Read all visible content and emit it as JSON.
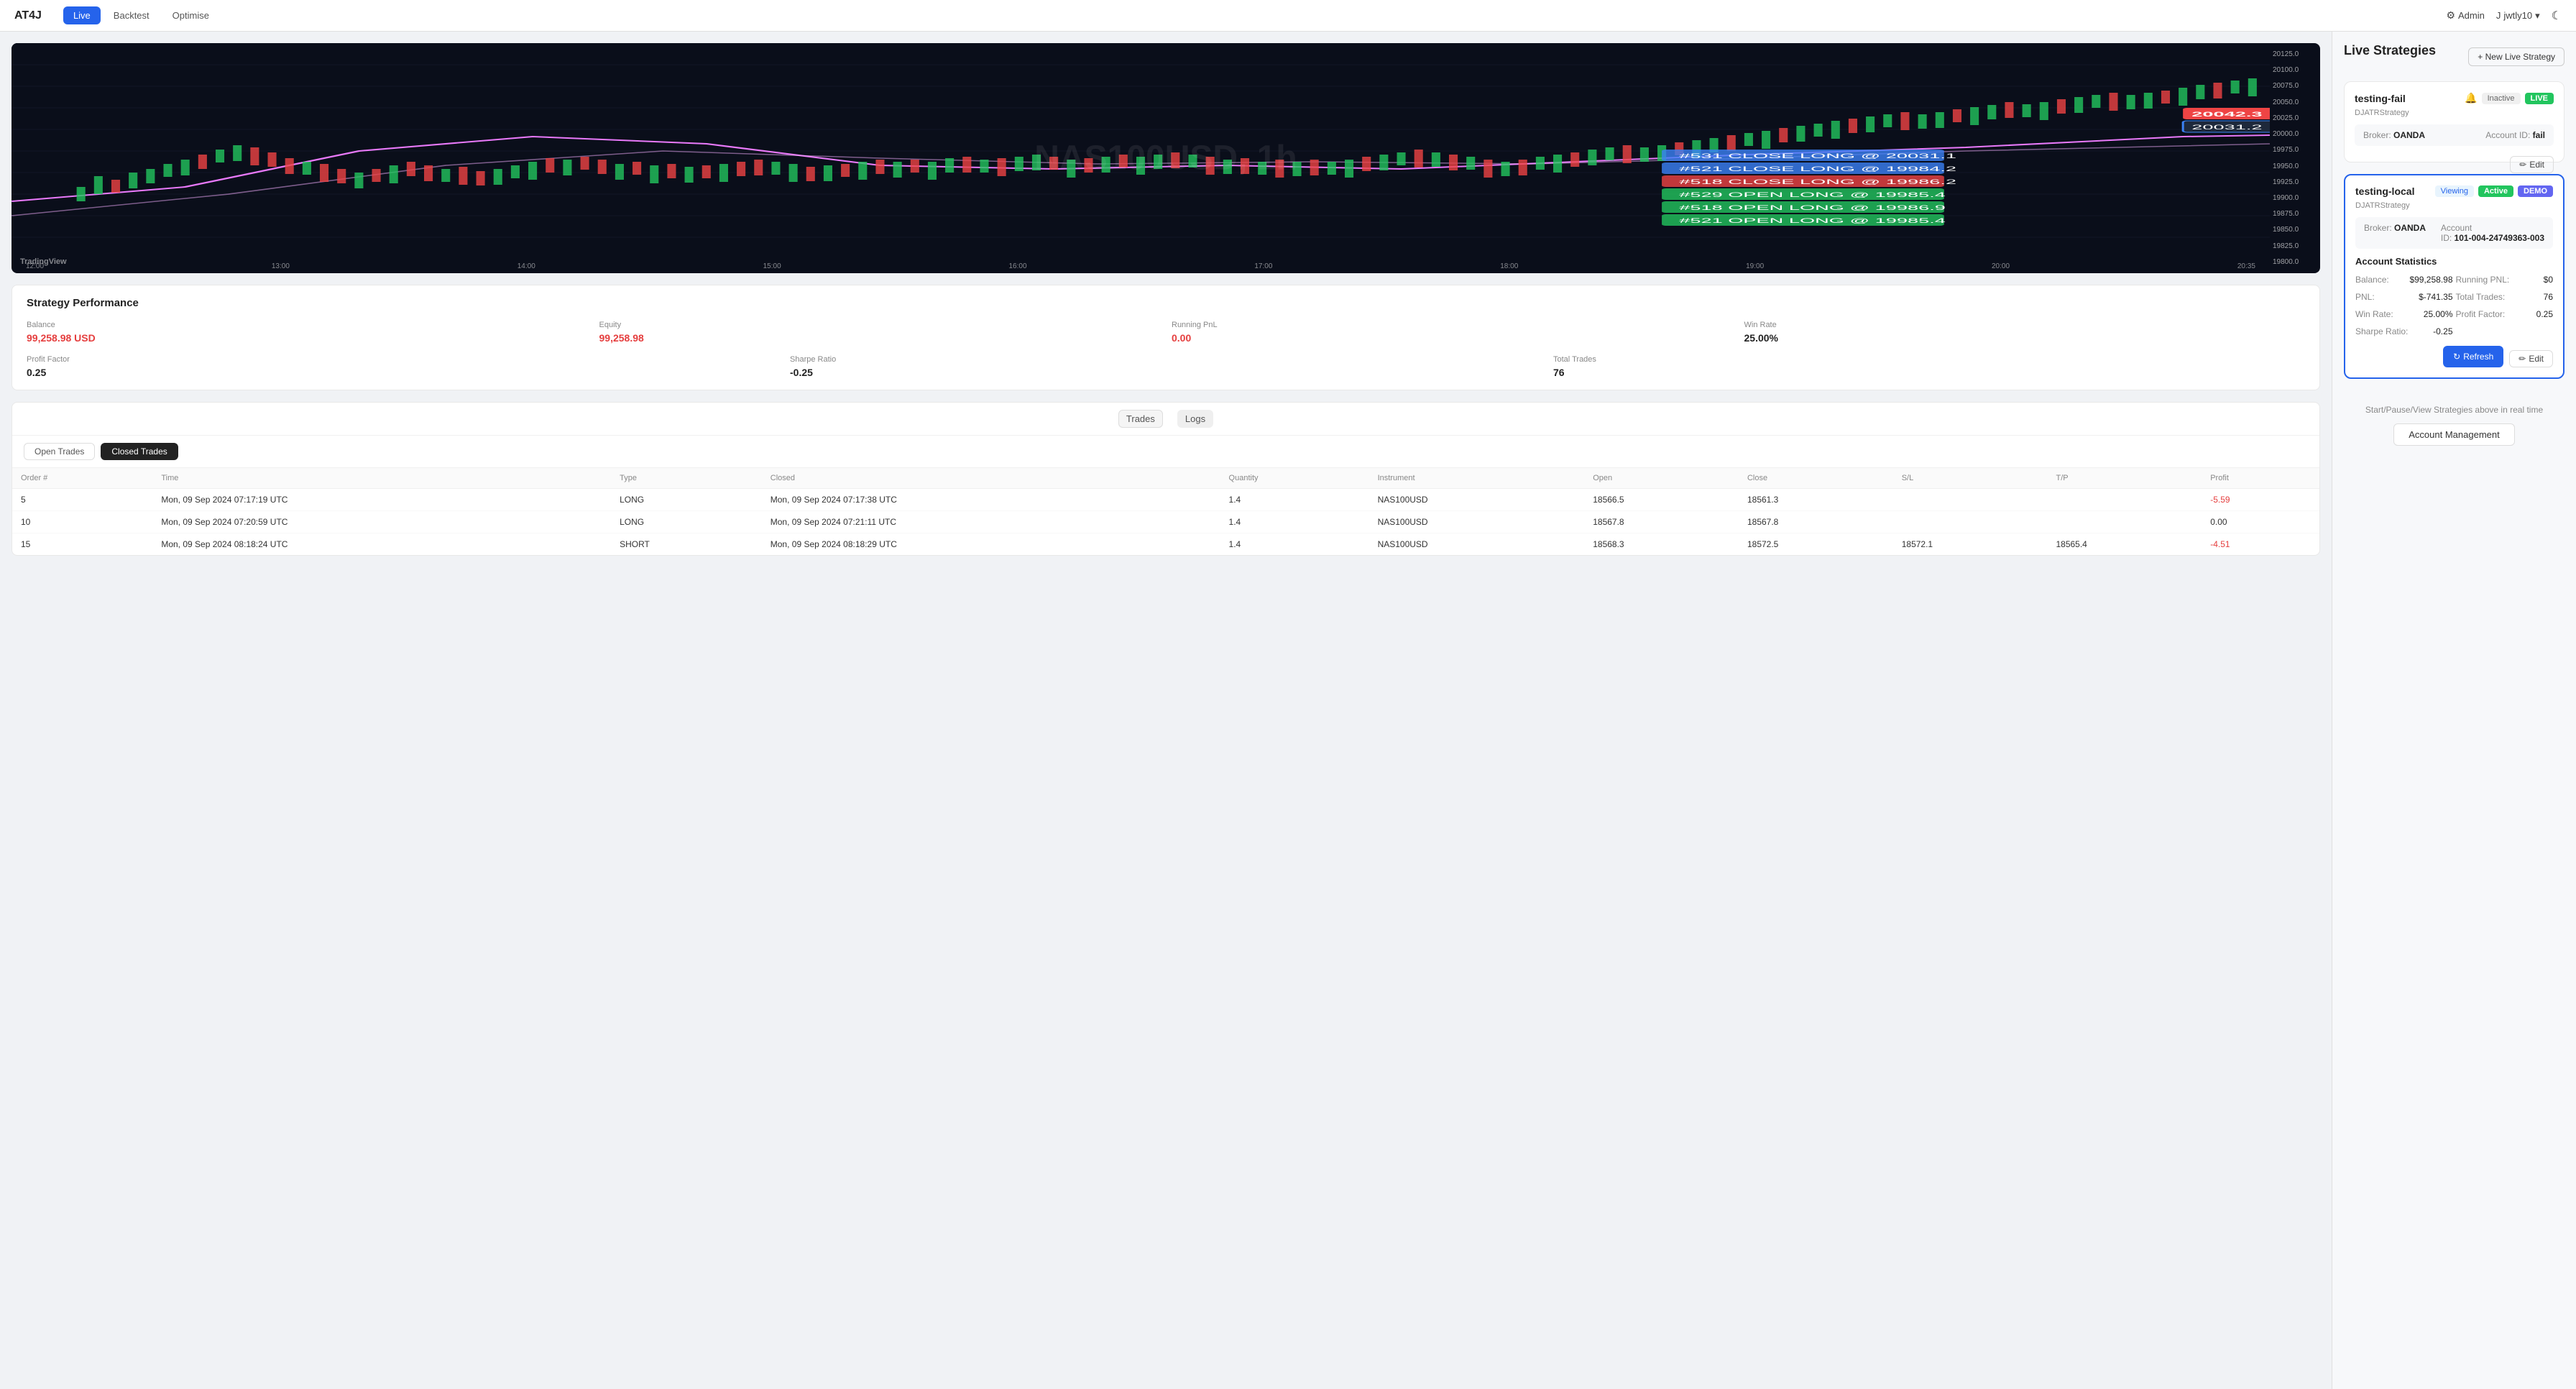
{
  "app": {
    "logo": "AT4J",
    "nav_tabs": [
      {
        "label": "Live",
        "active": true
      },
      {
        "label": "Backtest",
        "active": false
      },
      {
        "label": "Optimise",
        "active": false
      }
    ],
    "admin_label": "Admin",
    "user_label": "jwtly10",
    "theme_icon": "☾"
  },
  "chart": {
    "watermark": "NAS100USD, 1h",
    "tv_logo": "TradingView",
    "prices": [
      "20125.0",
      "20100.0",
      "20075.0",
      "20050.0",
      "20025.0",
      "20000.0",
      "19975.0",
      "19950.0",
      "19925.0",
      "19900.0",
      "19875.0",
      "19850.0",
      "19825.0",
      "19800.0"
    ],
    "times": [
      "12:00",
      "13:00",
      "14:00",
      "15:00",
      "16:00",
      "17:00",
      "18:00",
      "19:00",
      "20:00",
      "20:35"
    ],
    "price_highlight_1": "20042.3",
    "price_highlight_2": "20031.2"
  },
  "performance": {
    "title": "Strategy Performance",
    "balance_label": "Balance",
    "balance_val": "99,258.98 USD",
    "equity_label": "Equity",
    "equity_val": "99,258.98",
    "running_pnl_label": "Running PnL",
    "running_pnl_val": "0.00",
    "win_rate_label": "Win Rate",
    "win_rate_val": "25.00%",
    "profit_factor_label": "Profit Factor",
    "profit_factor_val": "0.25",
    "sharpe_ratio_label": "Sharpe Ratio",
    "sharpe_ratio_val": "-0.25",
    "total_trades_label": "Total Trades",
    "total_trades_val": "76"
  },
  "trades": {
    "tabs": [
      {
        "label": "Trades",
        "active": true
      },
      {
        "label": "Logs",
        "active": false
      }
    ],
    "subtabs": [
      {
        "label": "Open Trades",
        "active": false
      },
      {
        "label": "Closed Trades",
        "active": true
      }
    ],
    "columns": [
      "Order #",
      "Time",
      "Type",
      "Closed",
      "Quantity",
      "Instrument",
      "Open",
      "Close",
      "S/L",
      "T/P",
      "Profit"
    ],
    "rows": [
      {
        "order": "5",
        "time": "Mon, 09 Sep 2024 07:17:19 UTC",
        "type": "LONG",
        "closed": "Mon, 09 Sep 2024 07:17:38 UTC",
        "qty": "1.4",
        "instrument": "NAS100USD",
        "open": "18566.5",
        "close": "18561.3",
        "sl": "",
        "tp": "",
        "profit": "-5.59"
      },
      {
        "order": "10",
        "time": "Mon, 09 Sep 2024 07:20:59 UTC",
        "type": "LONG",
        "closed": "Mon, 09 Sep 2024 07:21:11 UTC",
        "qty": "1.4",
        "instrument": "NAS100USD",
        "open": "18567.8",
        "close": "18567.8",
        "sl": "",
        "tp": "",
        "profit": "0.00"
      },
      {
        "order": "15",
        "time": "Mon, 09 Sep 2024 08:18:24 UTC",
        "type": "SHORT",
        "closed": "Mon, 09 Sep 2024 08:18:29 UTC",
        "qty": "1.4",
        "instrument": "NAS100USD",
        "open": "18568.3",
        "close": "18572.5",
        "sl": "18572.1",
        "tp": "18565.4",
        "profit": "-4.51"
      }
    ]
  },
  "right_panel": {
    "title": "Live Strategies",
    "new_live_btn": "+ New Live Strategy",
    "strategies": [
      {
        "id": "s1",
        "name": "testing-fail",
        "type": "DJATRStrategy",
        "badges": [
          "Inactive",
          "LIVE"
        ],
        "broker_label": "Broker:",
        "broker_val": "OANDA",
        "account_id_label": "Account ID:",
        "account_id_val": "fail",
        "edit_label": "Edit",
        "selected": false
      },
      {
        "id": "s2",
        "name": "testing-local",
        "type": "DJATRStrategy",
        "badges": [
          "Viewing",
          "Active",
          "DEMO"
        ],
        "broker_label": "Broker:",
        "broker_val": "OANDA",
        "account_id_label": "Account ID:",
        "account_id_val": "101-004-24749363-003",
        "stats_title": "Account Statistics",
        "stats": [
          {
            "label": "Balance:",
            "val": "$99,258.98"
          },
          {
            "label": "Running PNL:",
            "val": "$0"
          },
          {
            "label": "PNL:",
            "val": "$-741.35"
          },
          {
            "label": "Total Trades:",
            "val": "76"
          },
          {
            "label": "Win Rate:",
            "val": "25.00%"
          },
          {
            "label": "Profit Factor:",
            "val": "0.25"
          },
          {
            "label": "Sharpe Ratio:",
            "val": "-0.25"
          }
        ],
        "refresh_label": "Refresh",
        "edit_label": "Edit",
        "selected": true
      }
    ],
    "account_mgmt_hint": "Start/Pause/View Strategies above in real time",
    "account_mgmt_label": "Account Management"
  }
}
